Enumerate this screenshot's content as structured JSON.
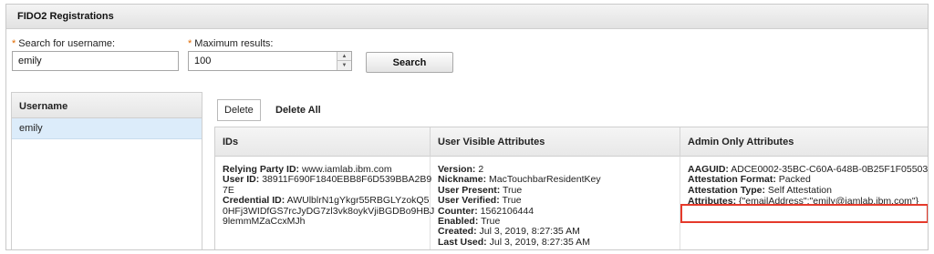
{
  "window": {
    "title": "FIDO2 Registrations"
  },
  "search": {
    "username_label": "Search for username:",
    "username_value": "emily",
    "max_label": "Maximum results:",
    "max_value": "100",
    "button_label": "Search",
    "required_marker": "*"
  },
  "users": {
    "header": "Username",
    "rows": [
      "emily"
    ]
  },
  "actions": {
    "delete_label": "Delete",
    "delete_all_label": "Delete All"
  },
  "table": {
    "headers": [
      "IDs",
      "User Visible Attributes",
      "Admin Only Attributes"
    ],
    "ids": {
      "rp_label": "Relying Party ID:",
      "rp_value": "www.iamlab.ibm.com",
      "user_label": "User ID:",
      "user_value_1": "38911F690F1840EBB8F6D539BBA2B9",
      "user_value_2": "7E",
      "cred_label": "Credential ID:",
      "cred_value_1": "AWUlblrN1gYkgr55RBGLYzokQ5",
      "cred_value_2": "0HFj3WIDfGS7rcJyDG7zl3vk8oykVjiBGDBo9HBJ",
      "cred_value_3": "9lemmMZaCcxMJh"
    },
    "user_visible": {
      "version_label": "Version:",
      "version_value": "2",
      "nickname_label": "Nickname:",
      "nickname_value": "MacTouchbarResidentKey",
      "present_label": "User Present:",
      "present_value": "True",
      "verified_label": "User Verified:",
      "verified_value": "True",
      "counter_label": "Counter:",
      "counter_value": "1562106444",
      "enabled_label": "Enabled:",
      "enabled_value": "True",
      "created_label": "Created:",
      "created_value": "Jul 3, 2019, 8:27:35 AM",
      "lastused_label": "Last Used:",
      "lastused_value": "Jul 3, 2019, 8:27:35 AM"
    },
    "admin_only": {
      "aaguid_label": "AAGUID:",
      "aaguid_value": "ADCE0002-35BC-C60A-648B-0B25F1F05503",
      "format_label": "Attestation Format:",
      "format_value": "Packed",
      "type_label": "Attestation Type:",
      "type_value": "Self Attestation",
      "attributes_label": "Attributes:",
      "attributes_value": "{\"emailAddress\":\"emily@iamlab.ibm.com\"}"
    }
  },
  "colors": {
    "highlight_border": "#e53a2b",
    "selected_row": "#dcecfa",
    "required": "#e06a00"
  }
}
